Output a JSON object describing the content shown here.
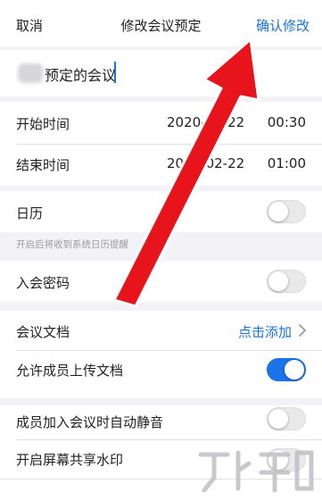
{
  "navbar": {
    "cancel": "取消",
    "title": "修改会议预定",
    "confirm": "确认修改"
  },
  "topic": {
    "value": "预定的会议"
  },
  "schedule": {
    "start": {
      "label": "开始时间",
      "date": "2020-02-22",
      "time": "00:30"
    },
    "end": {
      "label": "结束时间",
      "date": "2020-02-22",
      "time": "01:00"
    }
  },
  "calendar": {
    "label": "日历",
    "enabled": false,
    "hint": "开启后将收到系统日历提醒"
  },
  "password": {
    "label": "入会密码",
    "enabled": false
  },
  "documents": {
    "label": "会议文档",
    "action": "点击添加"
  },
  "allow_upload": {
    "label": "允许成员上传文档",
    "enabled": true
  },
  "auto_mute": {
    "label": "成员加入会议时自动静音",
    "enabled": false
  },
  "screen_watermark": {
    "label": "开启屏幕共享水印",
    "enabled": false
  },
  "colors": {
    "accent": "#1a73d9",
    "toggle_on": "#1a73e8",
    "arrow": "#e8141b"
  },
  "icons": [
    "chevron-right-icon",
    "annotation-arrow",
    "watermark-logo"
  ]
}
